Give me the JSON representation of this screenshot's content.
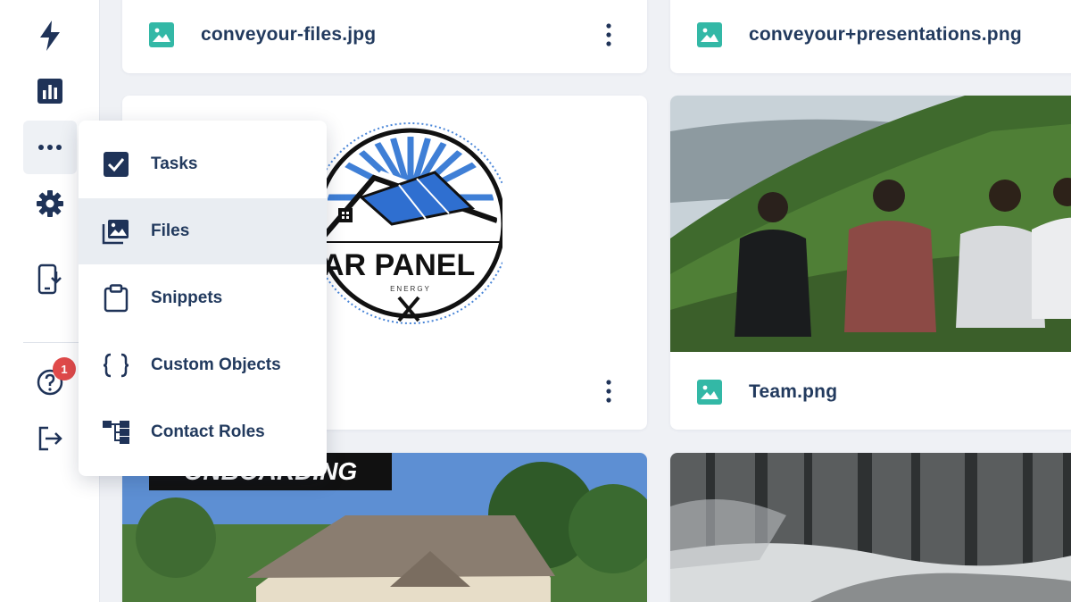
{
  "sidebar": {
    "icons": [
      "lightning-icon",
      "bar-chart-icon",
      "more-horizontal-icon",
      "gear-icon",
      "mobile-download-icon",
      "help-icon",
      "logout-icon"
    ],
    "notification_count": "1"
  },
  "menu": {
    "items": [
      {
        "label": "Tasks",
        "icon": "checkbox-icon"
      },
      {
        "label": "Files",
        "icon": "images-icon"
      },
      {
        "label": "Snippets",
        "icon": "clipboard-icon"
      },
      {
        "label": "Custom Objects",
        "icon": "braces-icon"
      },
      {
        "label": "Contact Roles",
        "icon": "hierarchy-icon"
      }
    ],
    "active_item": "Files"
  },
  "files": [
    {
      "name": "conveyour-files.jpg"
    },
    {
      "name": "conveyour+presentations.png"
    },
    {
      "name": "SOLAR PANEL logo",
      "logo_text": "OLAR PANEL",
      "logo_subtext": "ENERGY"
    },
    {
      "name": "Team.png"
    },
    {
      "name": "onboarding image",
      "banner_text": "ONBOARDING"
    },
    {
      "name": "forest image"
    }
  ],
  "colors": {
    "primary": "#1f3358",
    "file_icon": "#33b8a6",
    "badge": "#e04a4a",
    "background": "#eff1f5",
    "menu_active": "#e9edf2"
  }
}
